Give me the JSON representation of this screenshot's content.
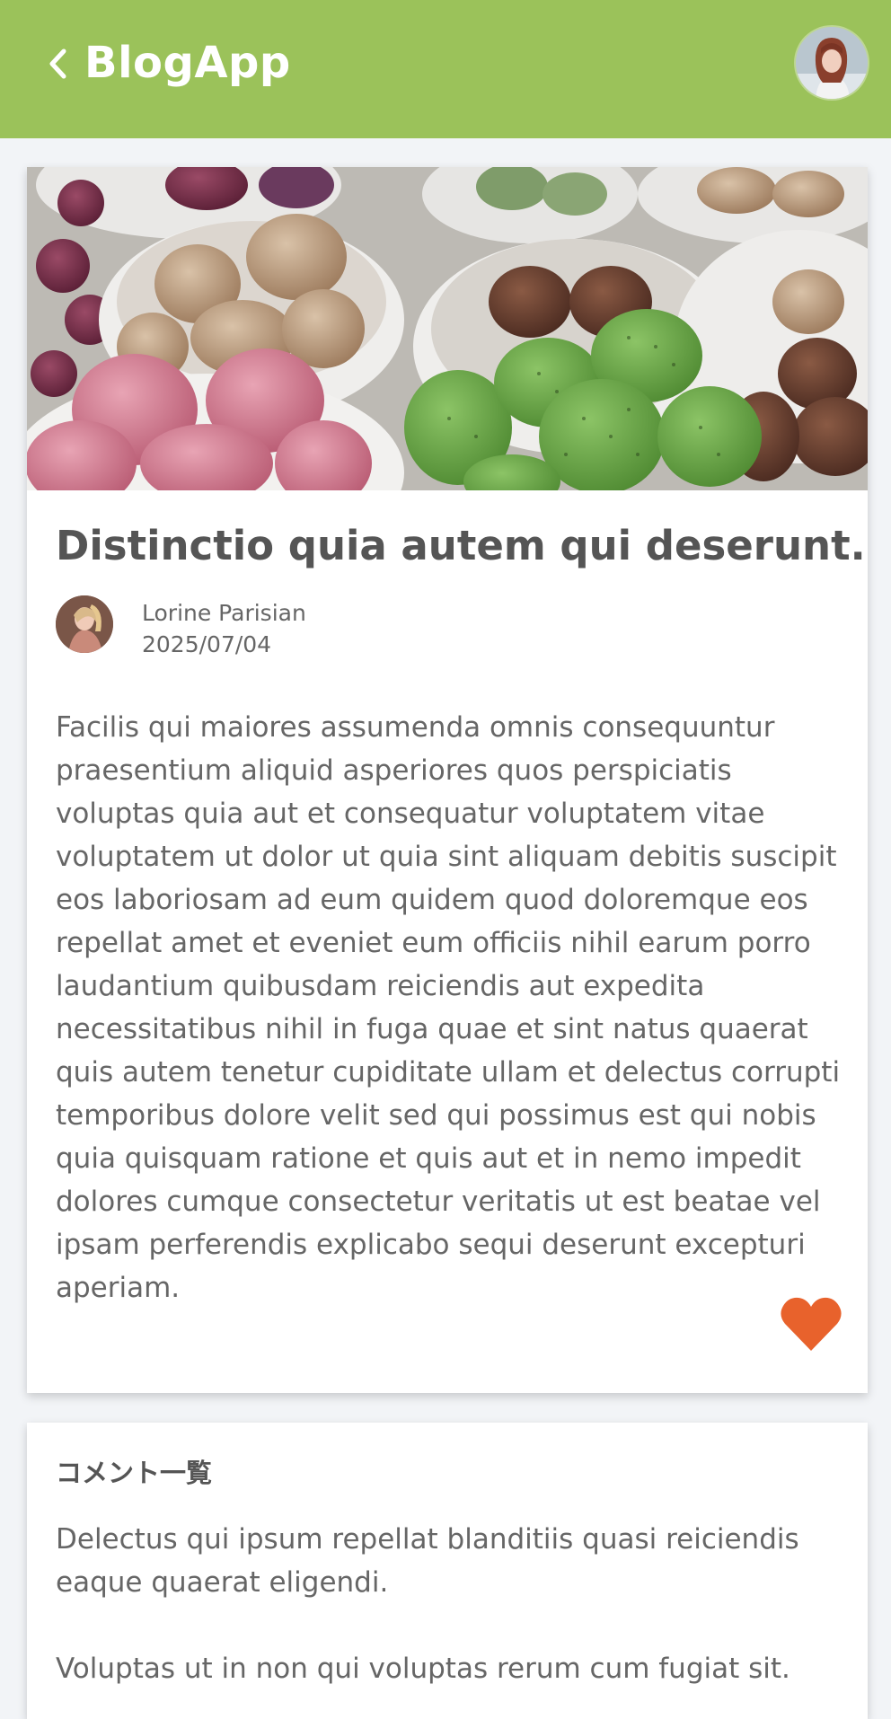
{
  "header": {
    "title": "BlogApp",
    "back_icon": "chevron-left-icon",
    "avatar_alt": "user-avatar",
    "bar_color": "#9bc25a"
  },
  "post": {
    "title": "Distinctio quia autem qui deserunt.",
    "author": "Lorine Parisian",
    "date": "2025/07/04",
    "body": "Facilis qui maiores assumenda omnis consequuntur praesentium aliquid asperiores quos perspiciatis voluptas quia aut et consequatur voluptatem vitae voluptatem ut dolor ut quia sint aliquam debitis suscipit eos laboriosam ad eum quidem quod doloremque eos repellat amet et eveniet eum officiis nihil earum porro laudantium quibusdam reiciendis aut expedita necessitatibus nihil in fuga quae et sint natus quaerat quis autem tenetur cupiditate ullam et delectus corrupti temporibus dolore velit sed qui possimus est qui nobis quia quisquam ratione et quis aut et in nemo impedit dolores cumque consectetur veritatis ut est beatae vel ipsam perferendis explicabo sequi deserunt excepturi aperiam.",
    "like_icon": "heart-icon",
    "like_color": "#e8622c"
  },
  "comments": {
    "heading": "コメント一覧",
    "items": [
      {
        "text": "Delectus qui ipsum repellat blanditiis quasi reiciendis eaque quaerat eligendi."
      },
      {
        "text": "Voluptas ut in non qui voluptas rerum cum fugiat sit."
      }
    ]
  }
}
